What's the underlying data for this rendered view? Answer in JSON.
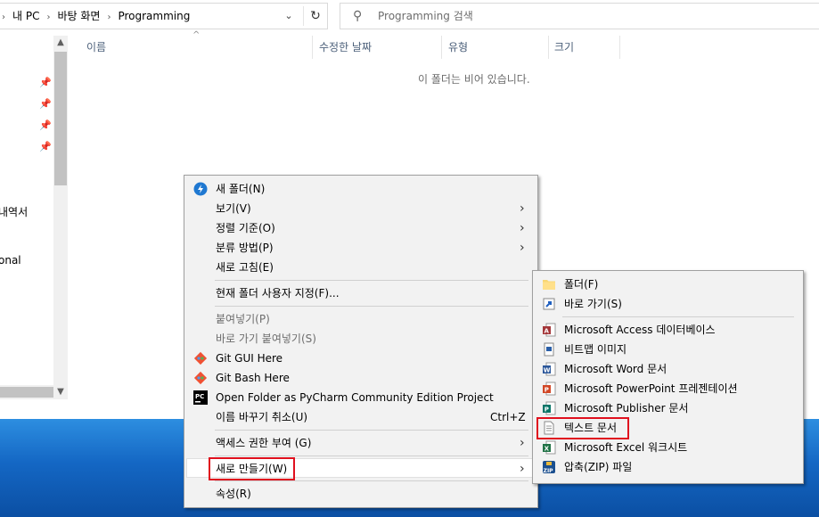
{
  "address": {
    "crumbs": [
      "내 PC",
      "바탕 화면",
      "Programming"
    ],
    "separator": "›",
    "dropdown_icon": "chevron-down",
    "refresh_icon": "refresh"
  },
  "search": {
    "placeholder": "Programming 검색"
  },
  "nav_pane": {
    "items": [
      "내역서",
      "onal"
    ]
  },
  "columns": [
    "이름",
    "수정한 날짜",
    "유형",
    "크기"
  ],
  "empty_message": "이 폴더는 비어 있습니다.",
  "context_menu": {
    "items": [
      {
        "label": "새 폴더(N)",
        "icon": "dropbox-icon"
      },
      {
        "label": "보기(V)",
        "submenu": true
      },
      {
        "label": "정렬 기준(O)",
        "submenu": true
      },
      {
        "label": "분류 방법(P)",
        "submenu": true
      },
      {
        "label": "새로 고침(E)"
      },
      {
        "label": "현재 폴더 사용자 지정(F)..."
      },
      {
        "label": "붙여넣기(P)",
        "disabled": true
      },
      {
        "label": "바로 가기 붙여넣기(S)",
        "disabled": true
      },
      {
        "label": "Git GUI Here",
        "icon": "git-icon"
      },
      {
        "label": "Git Bash Here",
        "icon": "git-icon"
      },
      {
        "label": "Open Folder as PyCharm Community Edition Project",
        "icon": "pycharm-icon"
      },
      {
        "label": "이름 바꾸기 취소(U)",
        "shortcut": "Ctrl+Z"
      },
      {
        "label": "액세스 권한 부여 (G)",
        "submenu": true
      },
      {
        "label": "새로 만들기(W)",
        "submenu": true,
        "highlighted": true
      },
      {
        "label": "속성(R)"
      }
    ]
  },
  "new_submenu": {
    "items": [
      {
        "label": "폴더(F)",
        "icon": "folder-icon"
      },
      {
        "label": "바로 가기(S)",
        "icon": "shortcut-icon"
      },
      {
        "label": "Microsoft Access 데이터베이스",
        "icon": "access-icon"
      },
      {
        "label": "비트맵 이미지",
        "icon": "bitmap-icon"
      },
      {
        "label": "Microsoft Word 문서",
        "icon": "word-icon"
      },
      {
        "label": "Microsoft PowerPoint 프레젠테이션",
        "icon": "powerpoint-icon"
      },
      {
        "label": "Microsoft Publisher 문서",
        "icon": "publisher-icon"
      },
      {
        "label": "텍스트 문서",
        "icon": "text-document-icon",
        "highlighted": true
      },
      {
        "label": "Microsoft Excel 워크시트",
        "icon": "excel-icon"
      },
      {
        "label": "압축(ZIP) 파일",
        "icon": "zip-icon"
      }
    ]
  },
  "colors": {
    "accent_red": "#e0101e",
    "menu_bg": "#f2f2f2",
    "desktop_blue": "#1467c4"
  }
}
